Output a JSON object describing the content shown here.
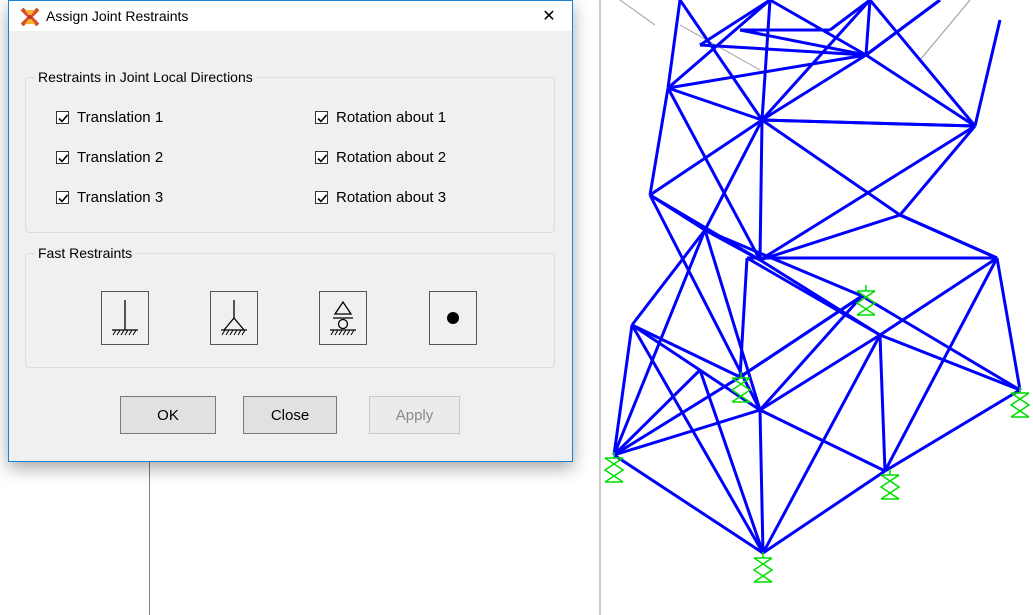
{
  "dialog": {
    "title": "Assign Joint Restraints",
    "app_icon": "sap2000-icon",
    "close_glyph": "✕",
    "restraints_group": {
      "label": "Restraints in Joint Local Directions",
      "checkboxes": [
        {
          "label": "Translation 1",
          "checked": true
        },
        {
          "label": "Translation 2",
          "checked": true
        },
        {
          "label": "Translation 3",
          "checked": true
        },
        {
          "label": "Rotation about 1",
          "checked": true
        },
        {
          "label": "Rotation about 2",
          "checked": true
        },
        {
          "label": "Rotation about 3",
          "checked": true
        }
      ]
    },
    "fast_group": {
      "label": "Fast Restraints",
      "buttons": [
        "fixed-support-icon",
        "pinned-support-icon",
        "roller-support-icon",
        "free-joint-icon"
      ]
    },
    "buttons": {
      "ok": "OK",
      "close": "Close",
      "apply": "Apply"
    }
  },
  "model_view": {
    "member_color": "#0000ff",
    "support_color": "#00dd00"
  }
}
